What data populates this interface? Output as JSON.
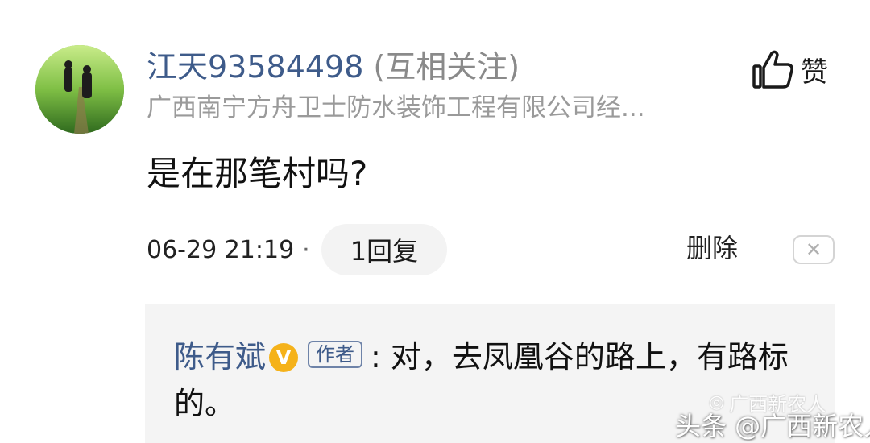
{
  "comment": {
    "username": "江天93584498",
    "relationship": "(互相关注)",
    "user_subtitle": "广西南宁方舟卫士防水装饰工程有限公司经...",
    "text": "是在那笔村吗?",
    "timestamp": "06-29 21:19",
    "separator": "·",
    "reply_count_label": "1回复",
    "like_label": "赞",
    "delete_label": "删除",
    "close_symbol": "✕"
  },
  "reply": {
    "author": "陈有斌",
    "verified_badge": "V",
    "author_tag": "作者",
    "text": ": 对，去凤凰谷的路上，有路标的。"
  },
  "watermark": {
    "wechat_label": "广西新农人",
    "toutiao_label": "头条 @广西新农人"
  },
  "colors": {
    "name_blue": "#3e5b8a",
    "muted_gray": "#9a9a9a",
    "reply_bg": "#f4f4f4",
    "pill_bg": "#f3f3f3",
    "badge_yellow": "#f5b21a"
  },
  "icons": [
    "avatar-photo",
    "thumbs-up-icon",
    "verified-v-icon",
    "close-icon",
    "wechat-icon"
  ]
}
